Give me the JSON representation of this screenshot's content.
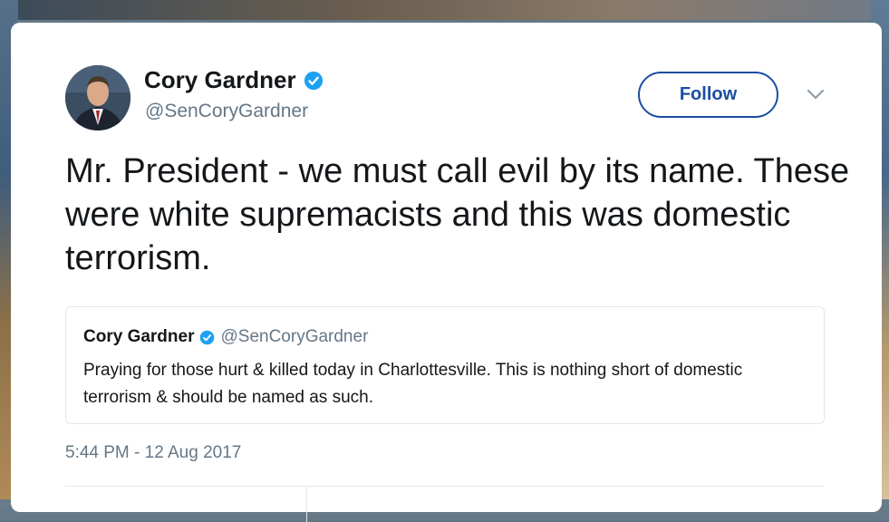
{
  "tweet": {
    "author_name": "Cory Gardner",
    "author_handle": "@SenCoryGardner",
    "follow_label": "Follow",
    "text": "Mr. President - we must call evil by its name. These were white supremacists and this was domestic terrorism.",
    "timestamp": "5:44 PM - 12 Aug 2017"
  },
  "quoted_tweet": {
    "author_name": "Cory Gardner",
    "author_handle": "@SenCoryGardner",
    "text": "Praying for those hurt & killed today in Charlottesville. This is nothing short of domestic terrorism & should be named as such."
  },
  "colors": {
    "verified_badge": "#1da1f2",
    "follow_accent": "#1b4ea0",
    "secondary_text": "#657786"
  },
  "icons": {
    "verified": "verified-badge-icon",
    "more": "chevron-down-icon"
  }
}
